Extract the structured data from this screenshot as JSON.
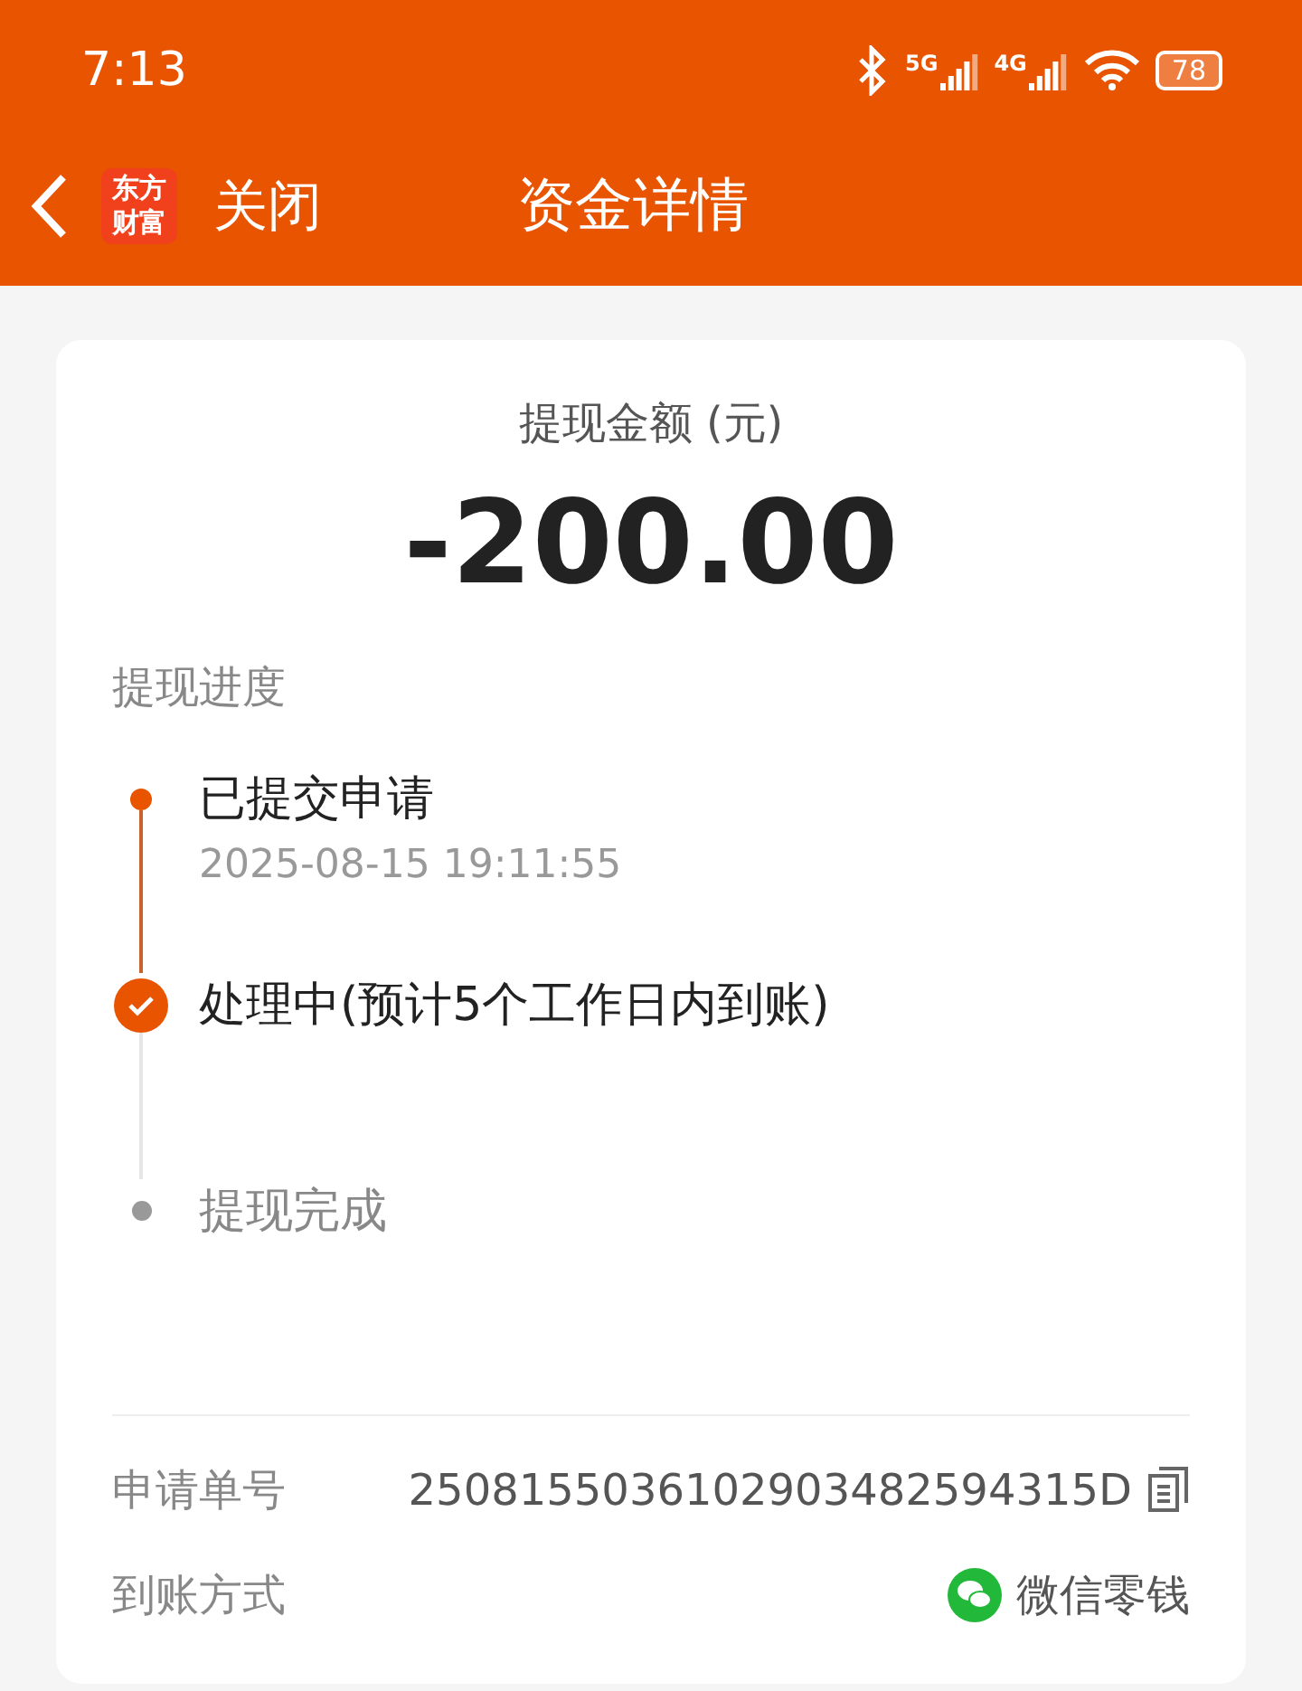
{
  "status_bar": {
    "time": "7:13",
    "network_1": "5G",
    "network_2": "4G",
    "battery": "78"
  },
  "header": {
    "logo": "东方财富",
    "close": "关闭",
    "title": "资金详情"
  },
  "summary": {
    "label": "提现金额 (元)",
    "amount": "-200.00"
  },
  "progress": {
    "title": "提现进度",
    "steps": [
      {
        "kind": "done",
        "label": "已提交申请",
        "time": "2025-08-15 19:11:55"
      },
      {
        "kind": "current",
        "label": "处理中(预计5个工作日内到账)"
      },
      {
        "kind": "pending",
        "label": "提现完成"
      }
    ]
  },
  "details": [
    {
      "kind": "copy",
      "label": "申请单号",
      "value": "2508155036102903482594315D"
    },
    {
      "kind": "wechat",
      "label": "到账方式",
      "value": "微信零钱"
    }
  ]
}
